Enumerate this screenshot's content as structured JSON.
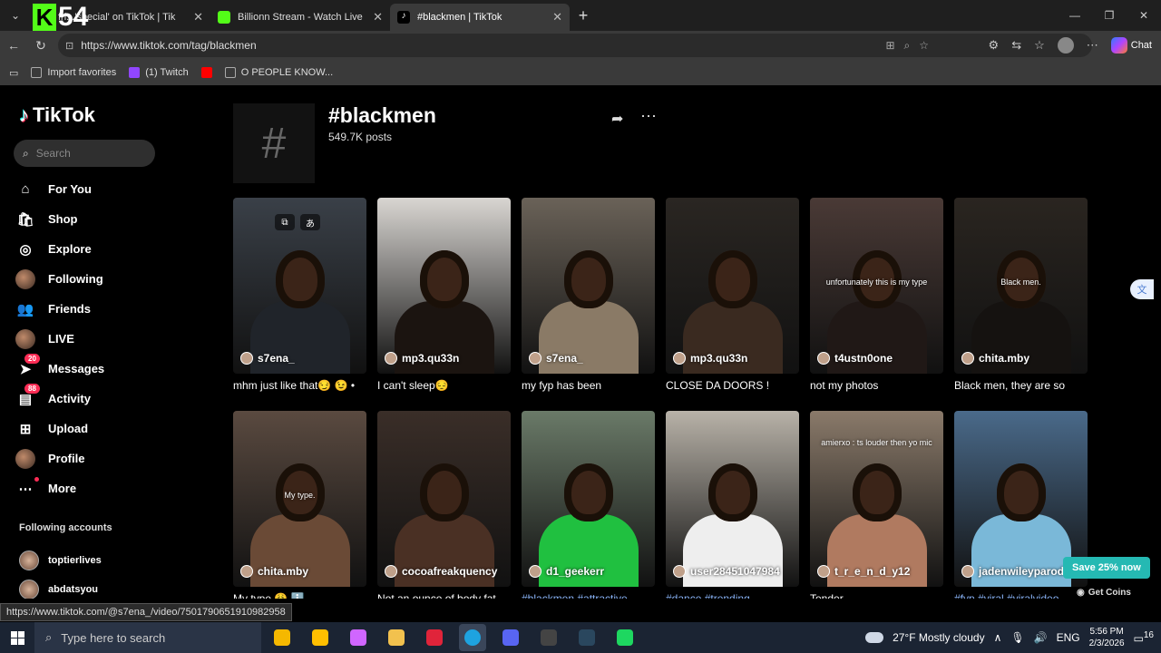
{
  "browser": {
    "tabs": [
      {
        "label": "fri...'special' on TikTok | Tik",
        "favicon_color": "#000000",
        "active": false
      },
      {
        "label": "Billionn Stream - Watch Live on Ki",
        "favicon_color": "#53fc18",
        "active": false
      },
      {
        "label": "#blackmen | TikTok",
        "favicon_color": "#000000",
        "active": true
      }
    ],
    "overlay_badge": {
      "letter": "K",
      "number": "54"
    },
    "url": "https://www.tiktok.com/tag/blackmen",
    "chat_label": "Chat",
    "favorites": [
      {
        "label": "Import favorites",
        "color": "#888888"
      },
      {
        "label": "(1) Twitch",
        "color": "#9146ff"
      },
      {
        "label": "",
        "color": "#ff0000"
      },
      {
        "label": "O PEOPLE KNOW...",
        "color": "#888888"
      }
    ],
    "status_url": "https://www.tiktok.com/@s7ena_/video/7501790651910982958"
  },
  "tiktok": {
    "logo_text": "TikTok",
    "search_placeholder": "Search",
    "nav": [
      {
        "label": "For You",
        "icon": "home-icon"
      },
      {
        "label": "Shop",
        "icon": "shop-icon"
      },
      {
        "label": "Explore",
        "icon": "compass-icon"
      },
      {
        "label": "Following",
        "icon": "avatar-icon"
      },
      {
        "label": "Friends",
        "icon": "friends-icon"
      },
      {
        "label": "LIVE",
        "icon": "avatar-icon"
      },
      {
        "label": "Messages",
        "icon": "send-icon",
        "badge": "20"
      },
      {
        "label": "Activity",
        "icon": "inbox-icon",
        "badge": "88"
      },
      {
        "label": "Upload",
        "icon": "plus-icon"
      },
      {
        "label": "Profile",
        "icon": "avatar-icon"
      },
      {
        "label": "More",
        "icon": "dots-icon"
      }
    ],
    "following_heading": "Following accounts",
    "following": [
      "toptierlives",
      "abdatsyou"
    ],
    "tag": {
      "title": "#blackmen",
      "posts": "549.7K posts"
    },
    "videos": [
      {
        "user": "s7ena_",
        "caption": "mhm just like that😏 😉 •",
        "bg": "#3a4048",
        "body": "#20242a",
        "tags": false
      },
      {
        "user": "mp3.qu33n",
        "caption": "I can't sleep😔",
        "bg": "#d9d6d2",
        "body": "#1b1410",
        "tags": false
      },
      {
        "user": "s7ena_",
        "caption": "my fyp has been",
        "bg": "#6a6258",
        "body": "#8a7a66",
        "tags": false
      },
      {
        "user": "mp3.qu33n",
        "caption": "CLOSE DA DOORS !",
        "bg": "#2a2622",
        "body": "#3a2a20",
        "tags": false,
        "overlay": ""
      },
      {
        "user": "t4ustn0one",
        "caption": "not my photos",
        "bg": "#4a3a36",
        "body": "#201816",
        "tags": false,
        "overlay": "unfortunately this is my type"
      },
      {
        "user": "chita.mby",
        "caption": "Black men, they are so",
        "bg": "#2a2520",
        "body": "#151210",
        "tags": false,
        "overlay": "Black men."
      },
      {
        "user": "chita.mby",
        "caption": "My type 😩 ℹ️",
        "bg": "#5a4a40",
        "body": "#6a4a36",
        "tags": false,
        "overlay": "My type."
      },
      {
        "user": "cocoafreakquency",
        "caption": "Not an ounce of body fat",
        "bg": "#3a2e28",
        "body": "#4a3024",
        "tags": false
      },
      {
        "user": "d1_geekerr",
        "caption": "#blackmen #attractive",
        "bg": "#6a7a68",
        "body": "#20c040",
        "tags": true
      },
      {
        "user": "user28451047984",
        "caption": "#dance #trending",
        "bg": "#b8b2a8",
        "body": "#eeeeee",
        "tags": true
      },
      {
        "user": "t_r_e_n_d_y12",
        "caption": "Tender.",
        "bg": "#8a7a6a",
        "body": "#b07a60",
        "tags": false,
        "overlay": "amierxo : ts louder then yo mic"
      },
      {
        "user": "jadenwileyparod",
        "caption": "#fyp #viral #viralvideo",
        "bg": "#4a6a8a",
        "body": "#7ab8d8",
        "tags": true
      }
    ],
    "save_button": "Save 25% now",
    "get_coins": "Get Coins"
  },
  "taskbar": {
    "search_placeholder": "Type here to search",
    "weather": "27°F  Mostly cloudy",
    "lang": "ENG",
    "time": "5:56 PM",
    "date": "2/3/2026",
    "notif_count": "16",
    "apps": [
      {
        "name": "copilot-app-icon",
        "color": "#f5b800"
      },
      {
        "name": "store-app-icon",
        "color": "#ffbf00"
      },
      {
        "name": "color-app-icon",
        "color": "#d066ff"
      },
      {
        "name": "explorer-app-icon",
        "color": "#f2c14e"
      },
      {
        "name": "wps-app-icon",
        "color": "#e0243a"
      },
      {
        "name": "edge-app-icon",
        "color": "#1ea3e0"
      },
      {
        "name": "discord-app-icon",
        "color": "#5865f2"
      },
      {
        "name": "obs-app-icon",
        "color": "#444444"
      },
      {
        "name": "steam-app-icon",
        "color": "#2a475e"
      },
      {
        "name": "spotify-app-icon",
        "color": "#1ed760"
      }
    ]
  }
}
